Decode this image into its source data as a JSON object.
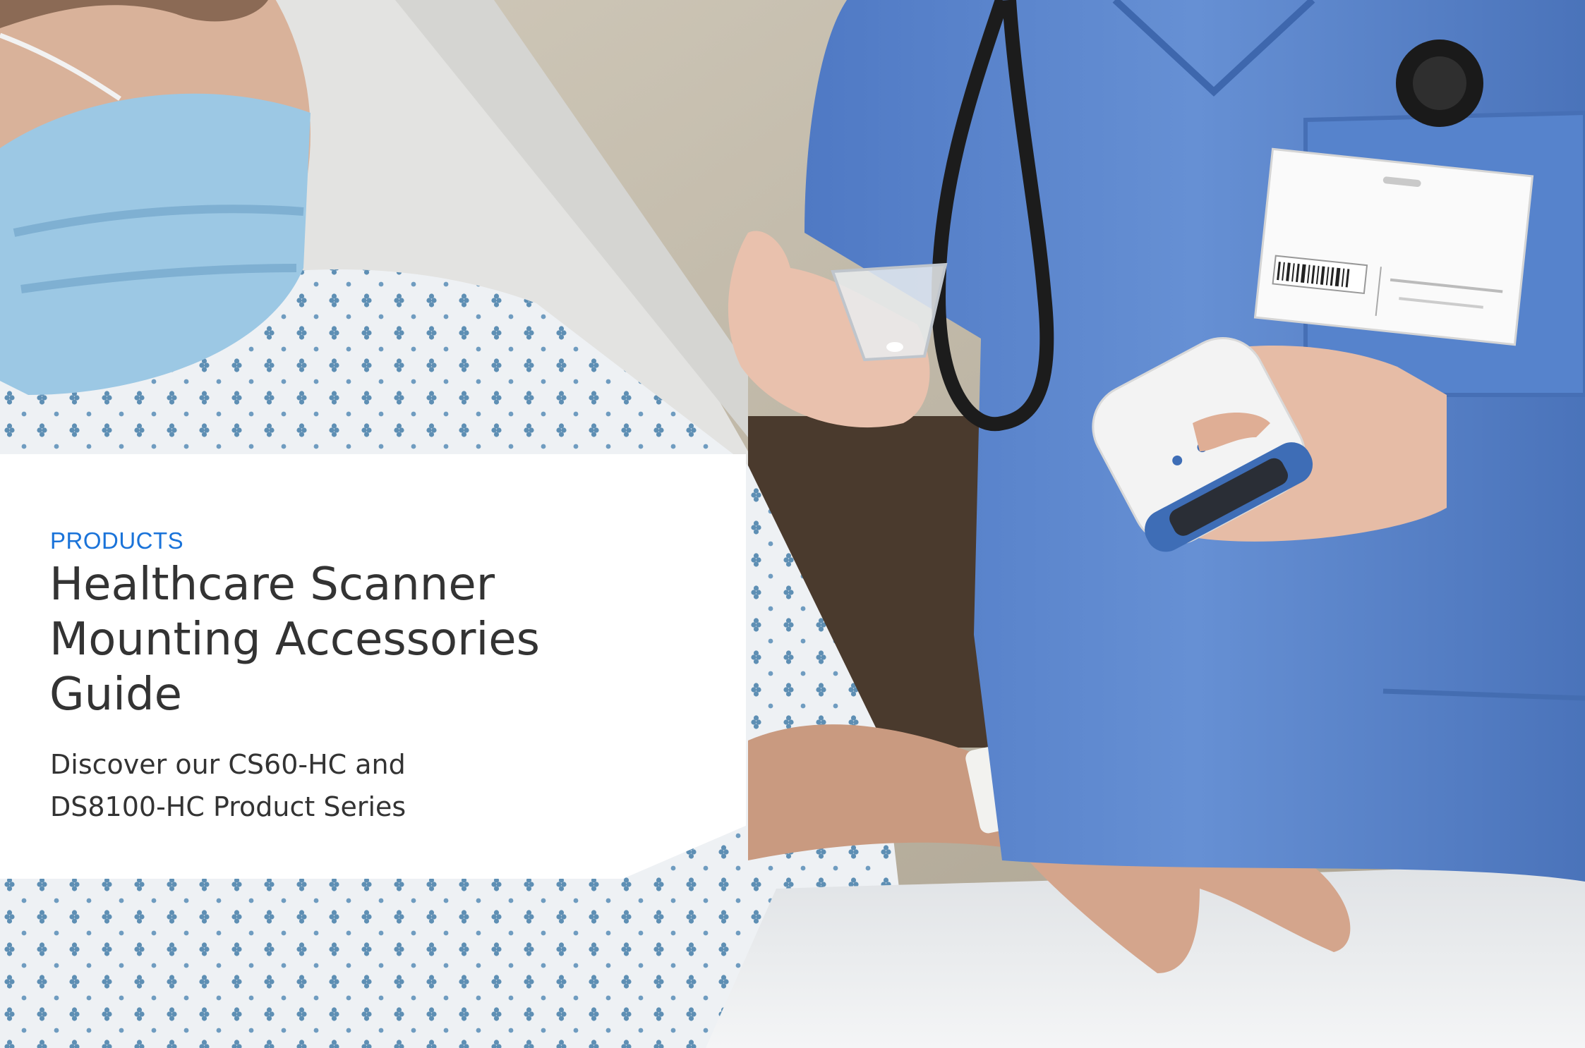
{
  "cover": {
    "eyebrow": "PRODUCTS",
    "title_lines": [
      "Healthcare Scanner",
      "Mounting Accessories",
      "Guide"
    ],
    "subtitle_lines": [
      "Discover our CS60-HC and",
      "DS8100-HC Product Series"
    ]
  },
  "photo": {
    "scrubs_color": "#5b86cc",
    "gown_color": "#eef1f4",
    "gown_dot_color": "#5e8fb4",
    "mask_color": "#9cc8e4",
    "skin_color": "#e2b7a0",
    "wall_color": "#c7bfae"
  },
  "accent_color": "#1a73d9"
}
